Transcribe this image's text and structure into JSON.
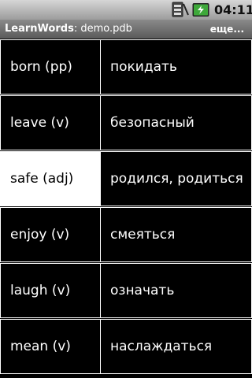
{
  "status_bar": {
    "time": "04:11",
    "icons": [
      "sim-no-signal-icon",
      "battery-charging-icon"
    ]
  },
  "title_bar": {
    "app_name": "LearnWords",
    "file_name": " demo.pdb",
    "menu_label": "еще..."
  },
  "words": [
    {
      "word": "born (pp)",
      "translation": "покидать",
      "selected": false
    },
    {
      "word": "leave (v)",
      "translation": "безопасный",
      "selected": false
    },
    {
      "word": "safe (adj)",
      "translation": "родился, родиться",
      "selected": true
    },
    {
      "word": "enjoy (v)",
      "translation": "смеяться",
      "selected": false
    },
    {
      "word": "laugh (v)",
      "translation": "означать",
      "selected": false
    },
    {
      "word": "mean (v)",
      "translation": "наслаждаться",
      "selected": false
    }
  ],
  "colors": {
    "background": "#000000",
    "grid_line": "#ffffff",
    "selected_background": "#ffffff",
    "battery_green": "#3ea83a"
  }
}
